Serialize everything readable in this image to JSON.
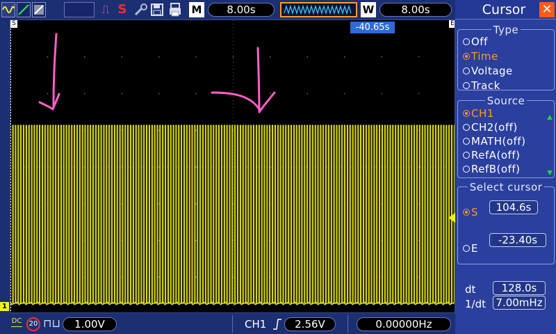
{
  "topbar": {
    "mode_icons": [
      "sine-wave-icon",
      "ramp-icon",
      "persist-icon"
    ],
    "run_glyph": "⎍",
    "single_glyph": "S",
    "wrench_glyph": "🔧",
    "save_glyph": "💾",
    "print_glyph": "▤",
    "main_label": "M",
    "main_timebase": "8.00s",
    "window_label": "W",
    "window_timebase": "8.00s"
  },
  "screen": {
    "cursor_flag": "-40.65s",
    "left_corner": "S",
    "right_corner": "E",
    "ch1_marker": "1",
    "trace_color": "#f1f11a",
    "annotation_color": "#ff5fc8"
  },
  "bottombar": {
    "coupling_glyph": "DC",
    "bw_limit": "20",
    "invert_glyph": "⊓⊔",
    "volts_div": "1.00V",
    "trig_source": "CH1",
    "trig_level": "2.56V",
    "trig_freq": "0.00000Hz"
  },
  "panel": {
    "title": "Cursor",
    "close_glyph": "✕",
    "type": {
      "title": "Type",
      "options": [
        {
          "label": "Off",
          "selected": false
        },
        {
          "label": "Time",
          "selected": true
        },
        {
          "label": "Voltage",
          "selected": false
        },
        {
          "label": "Track",
          "selected": false
        }
      ]
    },
    "source": {
      "title": "Source",
      "options": [
        {
          "label": "CH1",
          "selected": true
        },
        {
          "label": "CH2(off)",
          "selected": false
        },
        {
          "label": "MATH(off)",
          "selected": false
        },
        {
          "label": "RefA(off)",
          "selected": false
        },
        {
          "label": "RefB(off)",
          "selected": false
        }
      ]
    },
    "select_cursor": {
      "title": "Select cursor",
      "s_label": "S",
      "s_value": "104.6s",
      "e_label": "E",
      "e_value": "-23.40s",
      "s_selected": true
    },
    "readout": {
      "dt_label": "dt",
      "dt_value": "128.0s",
      "inv_label": "1/dt",
      "inv_value": "7.00mHz"
    }
  }
}
